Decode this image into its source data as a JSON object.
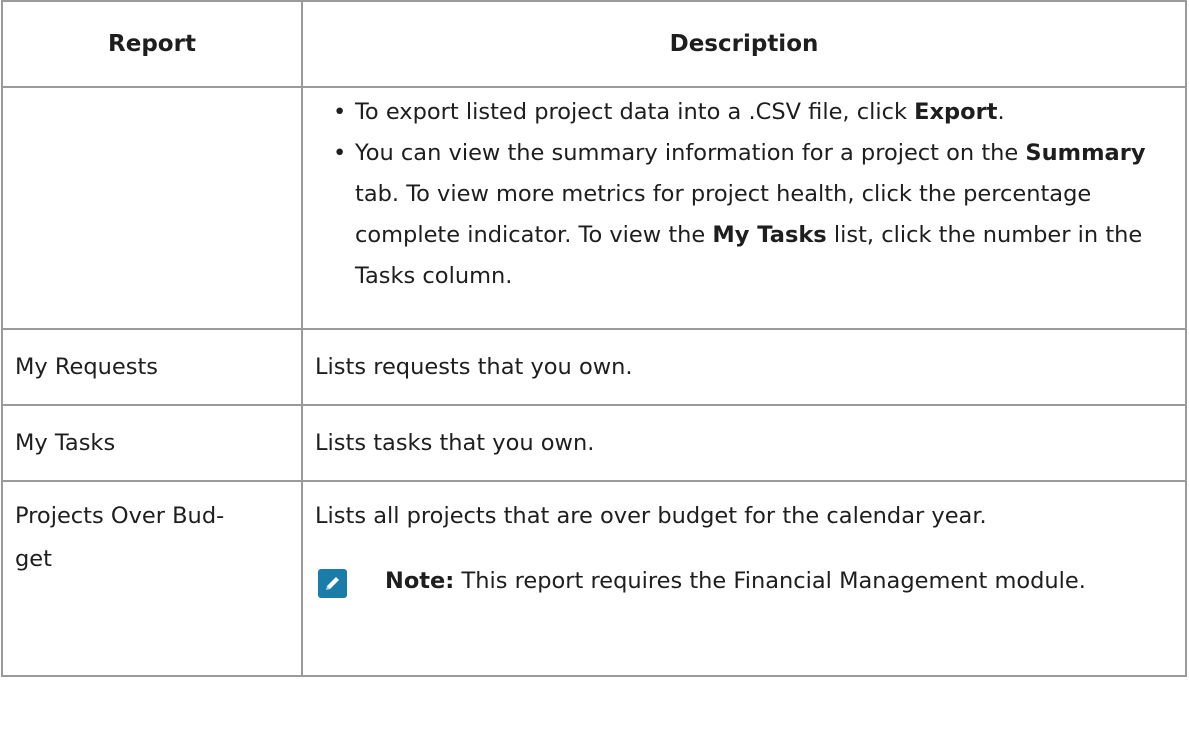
{
  "table": {
    "headers": {
      "report": "Report",
      "description": "Description"
    },
    "row_continued": {
      "report": "",
      "bullets": [
        {
          "bullet": "•",
          "t1": "To export listed project data into a .CSV file, click ",
          "b1": "Export",
          "t2": "."
        },
        {
          "bullet": "•",
          "t1": "You can view the summary information for a project on the ",
          "b1": "Summary",
          "t2": " tab. To view more metrics for project health, click the percentage complete indicator. To view the ",
          "b2": "My Tasks",
          "t3": " list, click the number in the Tasks column."
        }
      ]
    },
    "rows": [
      {
        "report": "My Requests",
        "description": "Lists requests that you own."
      },
      {
        "report": "My Tasks",
        "description": "Lists tasks that you own."
      }
    ],
    "row_budget": {
      "report": "Projects Over Bud-get",
      "description": "Lists all projects that are over budget for the calendar year.",
      "note_label": "Note:",
      "note_text": " This report requires the Financial Management module.",
      "note_icon": "pencil-note-icon",
      "note_icon_color": "#1a7ca8"
    }
  }
}
